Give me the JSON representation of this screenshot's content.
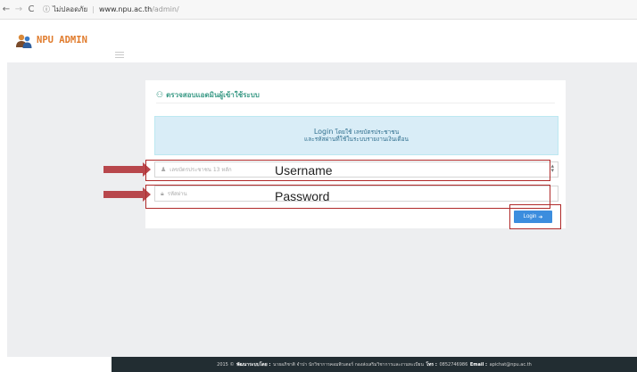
{
  "browser": {
    "back": "←",
    "forward": "→",
    "reload": "C",
    "info_icon": "ⓘ",
    "security_label": "ไม่ปลอดภัย",
    "url_host": "www.npu.ac.th",
    "url_path": "/admin/"
  },
  "header": {
    "brand": "NPU ADMIN",
    "logo_icon": "users-icon",
    "menu_icon": "hamburger-icon"
  },
  "panel": {
    "title": "ตรวจสอบแอดมินผู้เข้าใช้ระบบ",
    "info_line1_lead": "Login",
    "info_line1_rest": " โดยใช้ เลขบัตรประชาชน",
    "info_line2": "และรหัสผ่านที่ใช้ในระบบรายงานเงินเดือน",
    "username_placeholder": "เลขบัตรประชาชน 13 หลัก",
    "password_placeholder": "รหัสผ่าน",
    "login_label": "Login",
    "login_icon": "➔"
  },
  "annotations": {
    "username": "Username",
    "password": "Password",
    "color": "#b02a2a"
  },
  "footer": {
    "prefix": "2015 ©",
    "dev_label": "พัฒนาระบบโดย :",
    "dev_text": "นายอภิชาติ จำปา นักวิชาการคอมพิวเตอร์ กองส่งเสริมวิชาการและงานทะเบียน",
    "tel_label": "โทร :",
    "tel": "0852746986",
    "email_label": "Email :",
    "email": "apichat@npu.ac.th"
  },
  "colors": {
    "brand": "#e07b2c",
    "accent": "#3a9a86",
    "info_bg": "#d9edf7",
    "button": "#3c8dde",
    "footer_bg": "#222d32"
  }
}
